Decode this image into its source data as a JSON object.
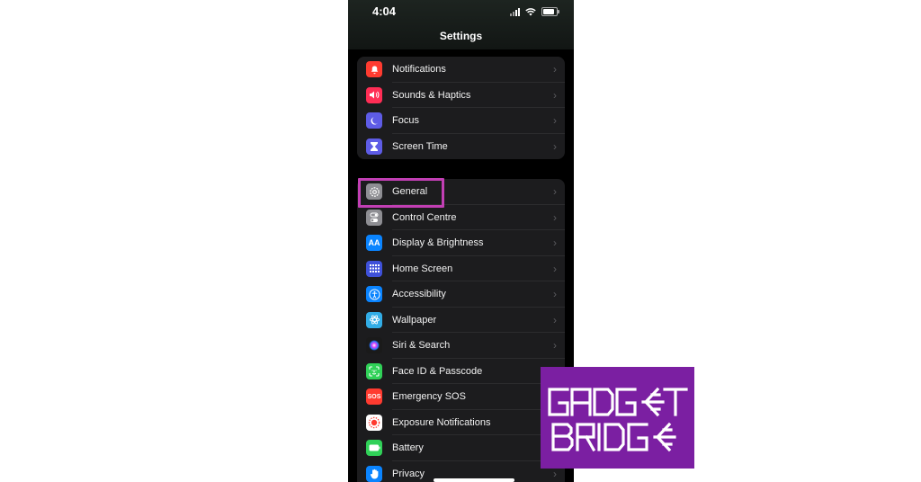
{
  "status_bar": {
    "time": "4:04"
  },
  "header": {
    "title": "Settings"
  },
  "groups": [
    {
      "items": [
        {
          "label": "Notifications",
          "icon": "notifications-icon",
          "color": "#ff3b30"
        },
        {
          "label": "Sounds & Haptics",
          "icon": "speaker-icon",
          "color": "#ff2d55"
        },
        {
          "label": "Focus",
          "icon": "moon-icon",
          "color": "#5e5ce6"
        },
        {
          "label": "Screen Time",
          "icon": "hourglass-icon",
          "color": "#5e5ce6"
        }
      ]
    },
    {
      "items": [
        {
          "label": "General",
          "icon": "gear-icon",
          "color": "#8e8e93"
        },
        {
          "label": "Control Centre",
          "icon": "toggles-icon",
          "color": "#8e8e93"
        },
        {
          "label": "Display & Brightness",
          "icon": "text-size-icon",
          "color": "#0a84ff"
        },
        {
          "label": "Home Screen",
          "icon": "app-grid-icon",
          "color": "#3f51d9"
        },
        {
          "label": "Accessibility",
          "icon": "accessibility-icon",
          "color": "#0a84ff"
        },
        {
          "label": "Wallpaper",
          "icon": "flower-icon",
          "color": "#32ade6"
        },
        {
          "label": "Siri & Search",
          "icon": "siri-icon",
          "color": "#222222"
        },
        {
          "label": "Face ID & Passcode",
          "icon": "face-id-icon",
          "color": "#30d158"
        },
        {
          "label": "Emergency SOS",
          "icon": "sos-icon",
          "color": "#ff3b30"
        },
        {
          "label": "Exposure Notifications",
          "icon": "exposure-icon",
          "color": "#ffffff"
        },
        {
          "label": "Battery",
          "icon": "battery-icon",
          "color": "#30d158"
        },
        {
          "label": "Privacy",
          "icon": "hand-icon",
          "color": "#0a84ff"
        }
      ]
    }
  ],
  "icon_text": {
    "display": "AA",
    "sos": "SOS"
  },
  "watermark": {
    "line1": "GADGET",
    "line2": "BRIDGE"
  }
}
